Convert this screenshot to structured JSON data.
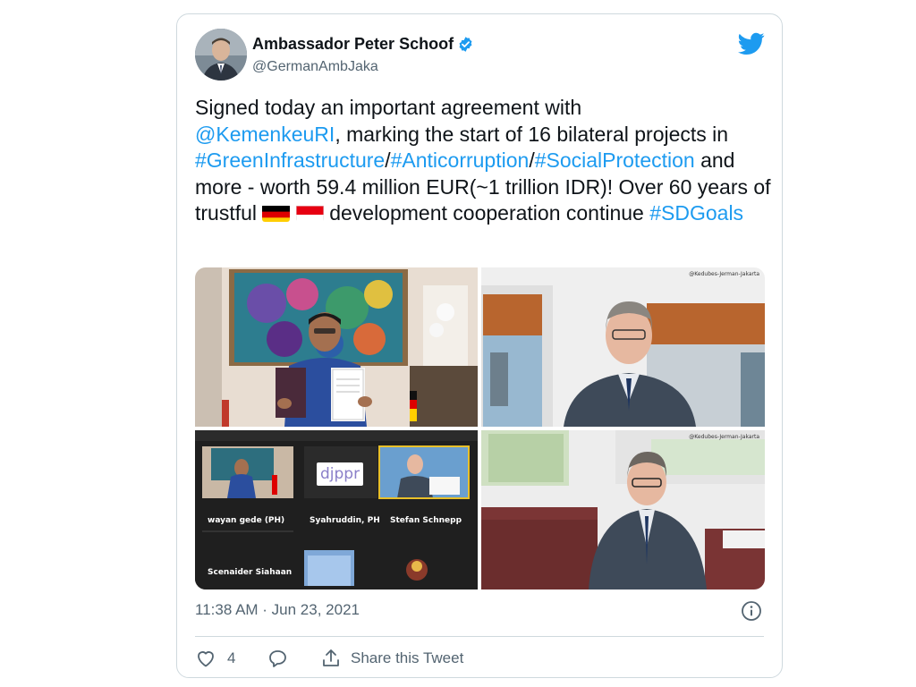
{
  "tweet": {
    "author_name": "Ambassador Peter Schoof",
    "handle": "@GermanAmbJaka",
    "text_parts": {
      "p1": "Signed today an important agreement with",
      "mention": "@KemenkeuRI",
      "p2": ", marking the start of 16 bilateral projects in ",
      "hashtag1": "#GreenInfrastructure",
      "sep1": "/",
      "hashtag2": "#Anticorruption",
      "sep2": "/",
      "hashtag3": "#SocialProtection",
      "p3": " and more - worth 59.4 million EUR(~1 trillion IDR)! Over 60 years of trustful ",
      "p4": " development cooperation continue ",
      "hashtag4": "#SDGoals"
    },
    "timestamp": "11:38 AM · Jun 23, 2021",
    "like_count": "4",
    "share_label": "Share this Tweet"
  },
  "media": {
    "watermark_top": "@Kedubes-Jerman-Jakarta",
    "watermark_bottom": "@Kedubes-Jerman-Jakarta",
    "call_tiles": {
      "tile1": "wayan gede (PH)",
      "tile2": "Syahruddin, PH",
      "tile3": "Stefan Schnepp",
      "tile4": "Scenaider Siahaan",
      "djppr_logo": "djppr"
    }
  },
  "icons": {
    "verified": "verified-badge-icon",
    "twitter": "twitter-bird-icon",
    "info": "info-icon",
    "like": "heart-icon",
    "reply": "reply-bubble-icon",
    "share": "share-icon"
  },
  "colors": {
    "link": "#1d9bf0",
    "text": "#0f1419",
    "muted": "#536471",
    "border": "#cfd9de"
  }
}
